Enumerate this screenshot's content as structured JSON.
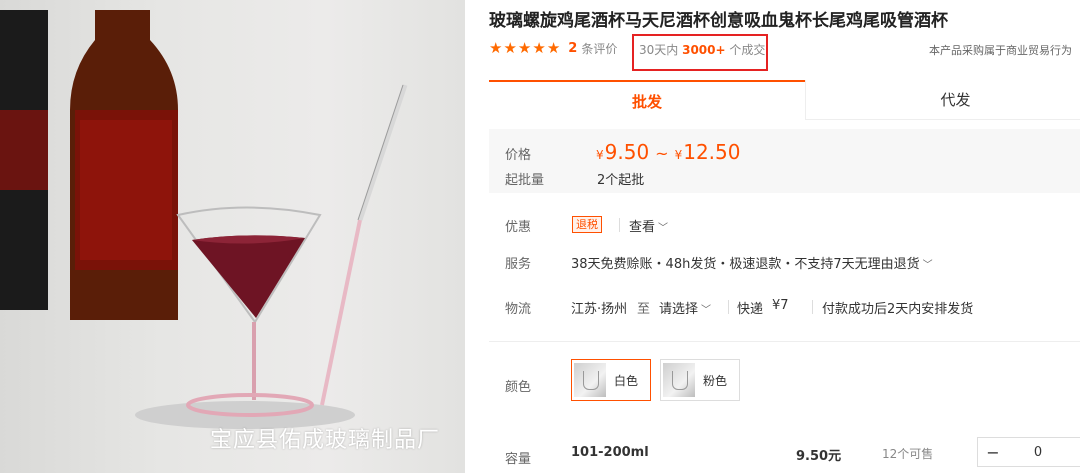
{
  "product": {
    "title": "玻璃螺旋鸡尾酒杯马天尼酒杯创意吸血鬼杯长尾鸡尾吸管酒杯",
    "image_watermark": "宝应县佑成玻璃制品厂"
  },
  "rating": {
    "stars": 5,
    "review_count": "2",
    "review_label": "条评价"
  },
  "sales": {
    "prefix": "30天内",
    "count": "3000+",
    "suffix": "个成交"
  },
  "trade_note": "本产品采购属于商业贸易行为",
  "tabs": [
    {
      "label": "批发",
      "active": true
    },
    {
      "label": "代发",
      "active": false
    }
  ],
  "pricing": {
    "price_label": "价格",
    "currency": "¥",
    "min_price": "9.50",
    "separator": "~",
    "max_price": "12.50",
    "moq_label": "起批量",
    "moq_value": "2个起批"
  },
  "promo": {
    "label": "优惠",
    "tag": "退税",
    "view_label": "查看"
  },
  "service": {
    "label": "服务",
    "text": "38天免费赊账・48h发货・极速退款・不支持7天无理由退货"
  },
  "logistics": {
    "label": "物流",
    "origin": "江苏·扬州",
    "to": "至",
    "select": "请选择",
    "express_label": "快递",
    "fee": "¥7",
    "dispatch": "付款成功后2天内安排发货"
  },
  "colors": {
    "label": "颜色",
    "options": [
      {
        "name": "白色",
        "selected": true
      },
      {
        "name": "粉色",
        "selected": false
      }
    ]
  },
  "capacity": {
    "label": "容量",
    "spec": "101-200ml",
    "price": "9.50元",
    "stock": "12个可售",
    "quantity": "0",
    "minus": "−"
  },
  "colors_hex": {
    "accent": "#ff5000",
    "highlight_box": "#e52222"
  }
}
